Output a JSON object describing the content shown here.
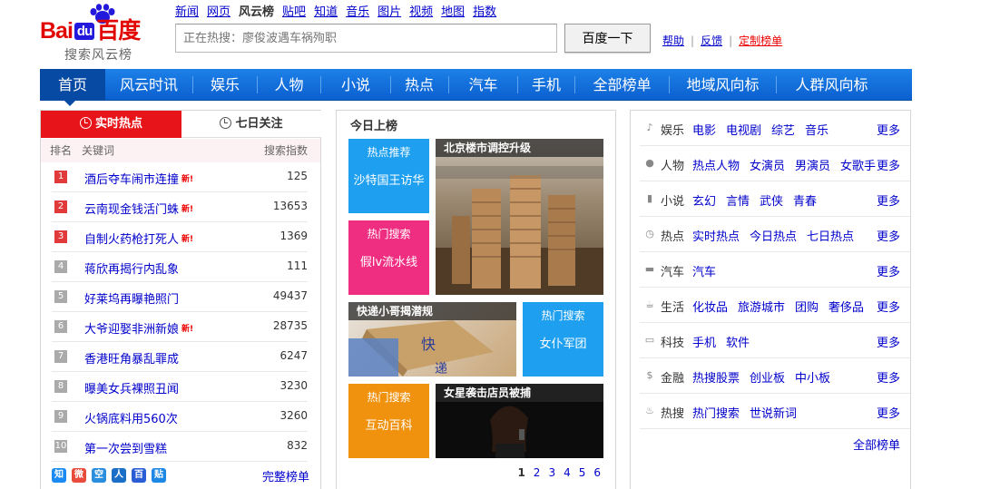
{
  "logo": {
    "text_bai": "Bai",
    "text_du": "du",
    "text_cn": "百度",
    "subtitle": "搜索风云榜"
  },
  "topnav": [
    "新闻",
    "网页",
    "风云榜",
    "贴吧",
    "知道",
    "音乐",
    "图片",
    "视频",
    "地图",
    "指数"
  ],
  "search": {
    "placeholder": "正在热搜：廖俊波遇车祸殉职",
    "button": "百度一下"
  },
  "toplinks": {
    "help": "帮助",
    "feedback": "反馈",
    "custom": "定制榜单"
  },
  "mainnav": [
    "首页",
    "风云时讯",
    "娱乐",
    "人物",
    "小说",
    "热点",
    "汽车",
    "手机",
    "全部榜单",
    "地域风向标",
    "人群风向标"
  ],
  "left": {
    "tab_realtime": "实时热点",
    "tab_week": "七日关注",
    "head": {
      "rank": "排名",
      "keyword": "关键词",
      "index": "搜索指数"
    },
    "rows": [
      {
        "rank": "1",
        "keyword": "酒后夺车闹市连撞",
        "new": "新!",
        "index": "125"
      },
      {
        "rank": "2",
        "keyword": "云南现金钱活门蛛",
        "new": "新!",
        "index": "13653"
      },
      {
        "rank": "3",
        "keyword": "自制火药枪打死人",
        "new": "新!",
        "index": "1369"
      },
      {
        "rank": "4",
        "keyword": "蒋欣再揭行内乱象",
        "new": "",
        "index": "111"
      },
      {
        "rank": "5",
        "keyword": "好莱坞再曝艳照门",
        "new": "",
        "index": "49437"
      },
      {
        "rank": "6",
        "keyword": "大爷迎娶非洲新娘",
        "new": "新!",
        "index": "28735"
      },
      {
        "rank": "7",
        "keyword": "香港旺角暴乱罪成",
        "new": "",
        "index": "6247"
      },
      {
        "rank": "8",
        "keyword": "曝美女兵裸照丑闻",
        "new": "",
        "index": "3230"
      },
      {
        "rank": "9",
        "keyword": "火锅底料用560次",
        "new": "",
        "index": "3260"
      },
      {
        "rank": "10",
        "keyword": "第一次尝到雪糕",
        "new": "",
        "index": "832"
      }
    ],
    "full_list": "完整榜单",
    "share_icons": [
      "zhidao-icon",
      "weibo-icon",
      "qzone-icon",
      "renren-icon",
      "baidu-paw-icon",
      "tieba-icon"
    ],
    "share_glyphs": [
      "知",
      "微",
      "空",
      "人",
      "百",
      "贴"
    ],
    "share_colors": [
      "#1b8af2",
      "#e94b3c",
      "#2a8ede",
      "#1b6fc6",
      "#2a5cd6",
      "#1e88e5"
    ]
  },
  "mid": {
    "title": "今日上榜",
    "tiles": [
      {
        "label": "热点推荐",
        "text": "沙特国王访华",
        "color": "#1e9ff0"
      },
      {
        "label": "热门搜索",
        "text": "假lv流水线",
        "color": "#ef2e82"
      },
      {
        "label": "热门搜索",
        "text": "女仆军团",
        "color": "#1e9ff0"
      },
      {
        "label": "热门搜索",
        "text": "互动百科",
        "color": "#f0920e"
      }
    ],
    "photos": [
      {
        "caption": "北京楼市调控升级"
      },
      {
        "caption": "快递小哥揭潜规"
      },
      {
        "caption": "女星袭击店员被捕"
      }
    ],
    "pages": [
      "1",
      "2",
      "3",
      "4",
      "5",
      "6"
    ]
  },
  "right": {
    "rows": [
      {
        "icon": "music-icon",
        "glyph": "♪",
        "cat": "娱乐",
        "links": [
          "电影",
          "电视剧",
          "综艺",
          "音乐"
        ],
        "more": "更多"
      },
      {
        "icon": "person-icon",
        "glyph": "●",
        "cat": "人物",
        "links": [
          "热点人物",
          "女演员",
          "男演员",
          "女歌手"
        ],
        "more": "更多"
      },
      {
        "icon": "book-icon",
        "glyph": "▮",
        "cat": "小说",
        "links": [
          "玄幻",
          "言情",
          "武侠",
          "青春"
        ],
        "more": "更多"
      },
      {
        "icon": "clock-icon",
        "glyph": "◷",
        "cat": "热点",
        "links": [
          "实时热点",
          "今日热点",
          "七日热点"
        ],
        "more": "更多"
      },
      {
        "icon": "car-icon",
        "glyph": "▬",
        "cat": "汽车",
        "links": [
          "汽车"
        ],
        "more": "更多"
      },
      {
        "icon": "cup-icon",
        "glyph": "☕",
        "cat": "生活",
        "links": [
          "化妆品",
          "旅游城市",
          "团购",
          "奢侈品"
        ],
        "more": "更多"
      },
      {
        "icon": "monitor-icon",
        "glyph": "▭",
        "cat": "科技",
        "links": [
          "手机",
          "软件"
        ],
        "more": "更多"
      },
      {
        "icon": "dollar-icon",
        "glyph": "$",
        "cat": "金融",
        "links": [
          "热搜股票",
          "创业板",
          "中小板"
        ],
        "more": "更多"
      },
      {
        "icon": "flame-icon",
        "glyph": "♨",
        "cat": "热搜",
        "links": [
          "热门搜索",
          "世说新词"
        ],
        "more": "更多"
      }
    ],
    "all_lists": "全部榜单"
  }
}
